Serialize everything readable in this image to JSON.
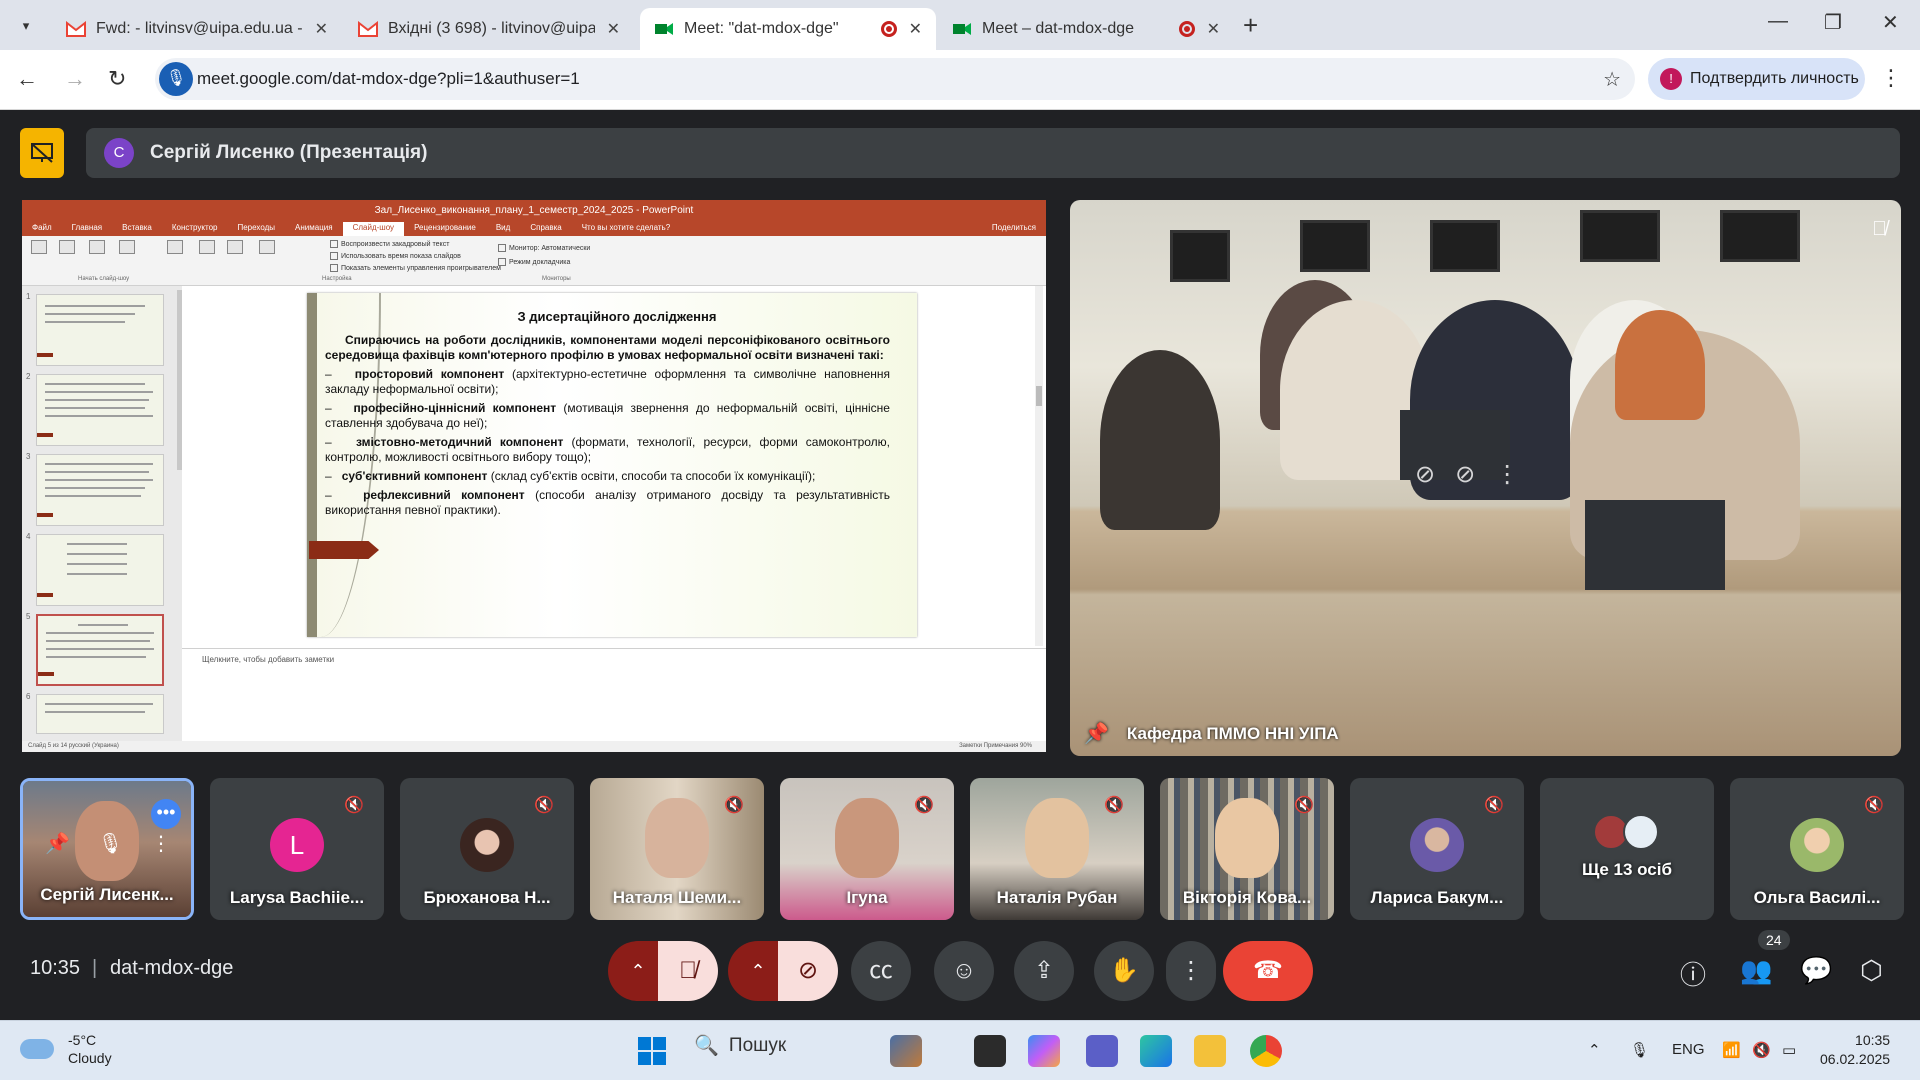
{
  "browser": {
    "tabs": [
      {
        "title": "Fwd: - litvinsv@uipa.edu.ua - по",
        "icon": "gmail-icon"
      },
      {
        "title": "Вхідні (3 698) - litvinov@uipa.e",
        "icon": "gmail-icon"
      },
      {
        "title": "Meet: \"dat-mdox-dge\"",
        "icon": "meet-icon"
      },
      {
        "title": "Meet – dat-mdox-dge",
        "icon": "meet-icon"
      }
    ],
    "url": "meet.google.com/dat-mdox-dge?pli=1&authuser=1",
    "verify_label": "Подтвердить личность"
  },
  "presenter": {
    "avatar_letter": "С",
    "name": "Сергій Лисенко (Презентація)"
  },
  "powerpoint": {
    "title": "Зал_Лисенко_виконання_плану_1_семестр_2024_2025 - PowerPoint",
    "menu": [
      "Файл",
      "Главная",
      "Вставка",
      "Конструктор",
      "Переходы",
      "Анимация",
      "Слайд-шоу",
      "Рецензирование",
      "Вид",
      "Справка",
      "Что вы хотите сделать?",
      "Поделиться"
    ],
    "selected_menu": "Слайд-шоу",
    "ribbon_checks": [
      "Воспроизвести закадровый текст",
      "Использовать время показа слайдов",
      "Показать элементы управления проигрывателем"
    ],
    "ribbon_monitor": "Монитор:  Автоматически",
    "ribbon_presenter": "Режим докладчика",
    "ribbon_groups": [
      "Начать слайд-шоу",
      "Настройка",
      "Мониторы"
    ],
    "slide": {
      "title": "З дисертаційного дослідження",
      "intro": "Спираючись на роботи дослідників, компонентами моделі персоніфікованого освітнього середовища фахівців комп'ютерного профілю в умовах неформальної освіти визначені такі:",
      "items": [
        {
          "term": "просторовий компонент",
          "desc": "(архітектурно-естетичне оформлення та символічне наповнення закладу неформальної освіти);"
        },
        {
          "term": "професійно-ціннісний компонент",
          "desc": "(мотивація звернення до неформальній освіті, ціннісне ставлення здобувача до неї);"
        },
        {
          "term": "змістовно-методичний компонент",
          "desc": "(формати, технології, ресурси, форми самоконтролю, контролю, можливості освітнього вибору тощо);"
        },
        {
          "term": "суб'єктивний компонент",
          "desc": "(склад суб'єктів освіти, способи та способи їх комунікації);"
        },
        {
          "term": "рефлексивний компонент",
          "desc": "(способи аналізу отриманого досвіду та результативність використання певної практики)."
        }
      ]
    },
    "thumb_numbers": [
      "1",
      "2",
      "3",
      "4",
      "5",
      "6"
    ],
    "notes_placeholder": "Щелкните, чтобы добавить заметки",
    "status_left": "Слайд 5 из 14     русский (Украина)",
    "status_right": "Заметки    Примечания          90%"
  },
  "camera": {
    "label": "Кафедра ПММО ННІ УІПА"
  },
  "participants": [
    {
      "name": "Сергій Лисенк...",
      "type": "video",
      "self": true
    },
    {
      "name": "Larysa Bachiie...",
      "type": "letter",
      "letter": "L",
      "color": "#e52592"
    },
    {
      "name": "Брюханова Н...",
      "type": "photo"
    },
    {
      "name": "Наталя Шеми...",
      "type": "video"
    },
    {
      "name": "Ігуna",
      "type": "video"
    },
    {
      "name": "Наталія Рубан",
      "type": "video"
    },
    {
      "name": "Вікторія Кова...",
      "type": "video"
    },
    {
      "name": "Лариса Бакум...",
      "type": "photo"
    },
    {
      "name": "Ще 13 осіб",
      "type": "more"
    },
    {
      "name": "Ольга Василі...",
      "type": "photo"
    }
  ],
  "meet_bar": {
    "time": "10:35",
    "separator": "|",
    "code": "dat-mdox-dge",
    "people_count": "24"
  },
  "taskbar": {
    "temp": "-5°C",
    "weather": "Cloudy",
    "search": "Пошук",
    "lang": "ENG",
    "time": "10:35",
    "date": "06.02.2025"
  },
  "colors": {
    "meet_bg": "#202124",
    "end_call": "#ea4335",
    "mute_on": "#f28b82",
    "presenter_icon": "#f5b400",
    "powerpoint": "#b7472a"
  }
}
